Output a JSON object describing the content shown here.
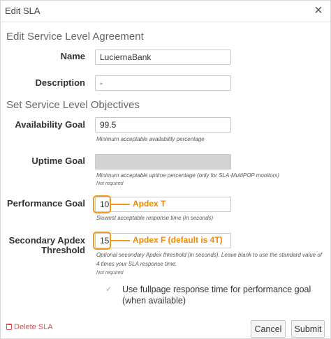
{
  "dialog": {
    "title": "Edit SLA",
    "close_glyph": "×"
  },
  "sections": {
    "sla_title": "Edit Service Level Agreement",
    "slo_title": "Set Service Level Objectives"
  },
  "fields": {
    "name": {
      "label": "Name",
      "value": "LuciernaBank"
    },
    "description": {
      "label": "Description",
      "value": "-"
    },
    "availability": {
      "label": "Availability Goal",
      "value": "99.5",
      "help": "Minimum acceptable availability percentage"
    },
    "uptime": {
      "label": "Uptime Goal",
      "value": "",
      "help": "Minimum acceptable uptime percentage (only for SLA-MultiPOP monitors)",
      "required": "Not required"
    },
    "performance": {
      "label": "Performance Goal",
      "value": "10",
      "help": "Slowest acceptable response time (in seconds)"
    },
    "secondary_apdex": {
      "label_line1": "Secondary Apdex",
      "label_line2": "Threshold",
      "value": "15",
      "help_line1": "Optional secondary Apdex threshold (in seconds). Leave blank to use the standard value of",
      "help_line2": "4 times your SLA response time.",
      "required": "Not required"
    }
  },
  "annotations": {
    "apdex_t": "Apdex T",
    "apdex_f": "Apdex F (default is 4T)",
    "color": "#f39a1e"
  },
  "checkbox": {
    "label": "Use fullpage response time for performance goal (when available)",
    "icon": "check-icon"
  },
  "footer": {
    "delete_label": "Delete SLA",
    "cancel_label": "Cancel",
    "submit_label": "Submit"
  }
}
